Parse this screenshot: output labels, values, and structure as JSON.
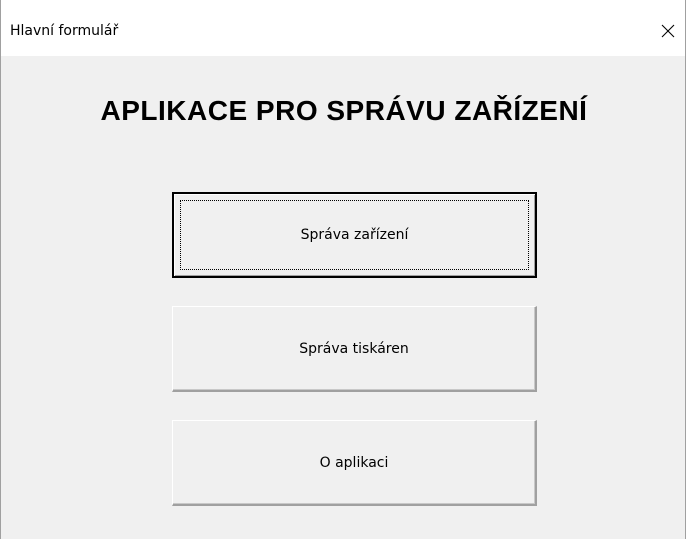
{
  "window": {
    "title": "Hlavní formulář",
    "close_icon": "close-icon"
  },
  "main": {
    "heading": "APLIKACE PRO SPRÁVU ZAŘÍZENÍ",
    "buttons": [
      {
        "label": "Správa zařízení",
        "state": "default-focused"
      },
      {
        "label": "Správa tiskáren",
        "state": "normal"
      },
      {
        "label": "O aplikaci",
        "state": "normal"
      }
    ]
  },
  "colors": {
    "form_background": "#f0f0f0",
    "titlebar_background": "#ffffff",
    "text": "#000000"
  }
}
